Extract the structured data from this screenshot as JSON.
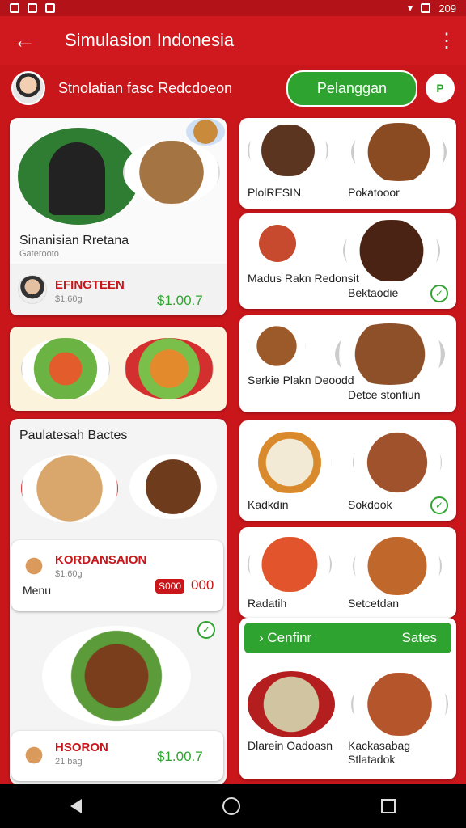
{
  "status": {
    "time": "209"
  },
  "appbar": {
    "title": "Simulasion Indonesia"
  },
  "subbar": {
    "title": "Stnolatian fasc Redcdoeon",
    "button": "Pelanggan",
    "circle": "P"
  },
  "left": {
    "hero": {
      "title": "Sinanisian Rretana",
      "sub": "Gaterooto",
      "name": "EFINGTEEN",
      "meta": "$1.60g",
      "price": "$1.00.7"
    },
    "section": {
      "title": "Paulatesah Bactes",
      "name": "KORDANSAION",
      "meta": "$1.60g",
      "extra": "Menu",
      "badge": "S000",
      "price": "000"
    },
    "bottom": {
      "name": "HSORON",
      "meta": "21 bag",
      "price": "$1.00.7"
    }
  },
  "right": {
    "r1": {
      "a": "PlolRESIN",
      "b": "Pokatooor"
    },
    "r2": {
      "a": "Madus Rakn Redonsit",
      "b": "Bektaodie"
    },
    "r3": {
      "a": "Serkie Plakn Deoodd",
      "b": "Detce stonfiun"
    },
    "r4": {
      "a": "Kadkdin",
      "b": "Sokdook"
    },
    "r5": {
      "a": "Radatih",
      "b": "Setcetdan"
    },
    "green": {
      "left": "› Cenfinr",
      "right": "Sates"
    },
    "r6": {
      "a": "Dlarein Oadoasn",
      "b": "Kackasabag Stlatadok"
    }
  }
}
